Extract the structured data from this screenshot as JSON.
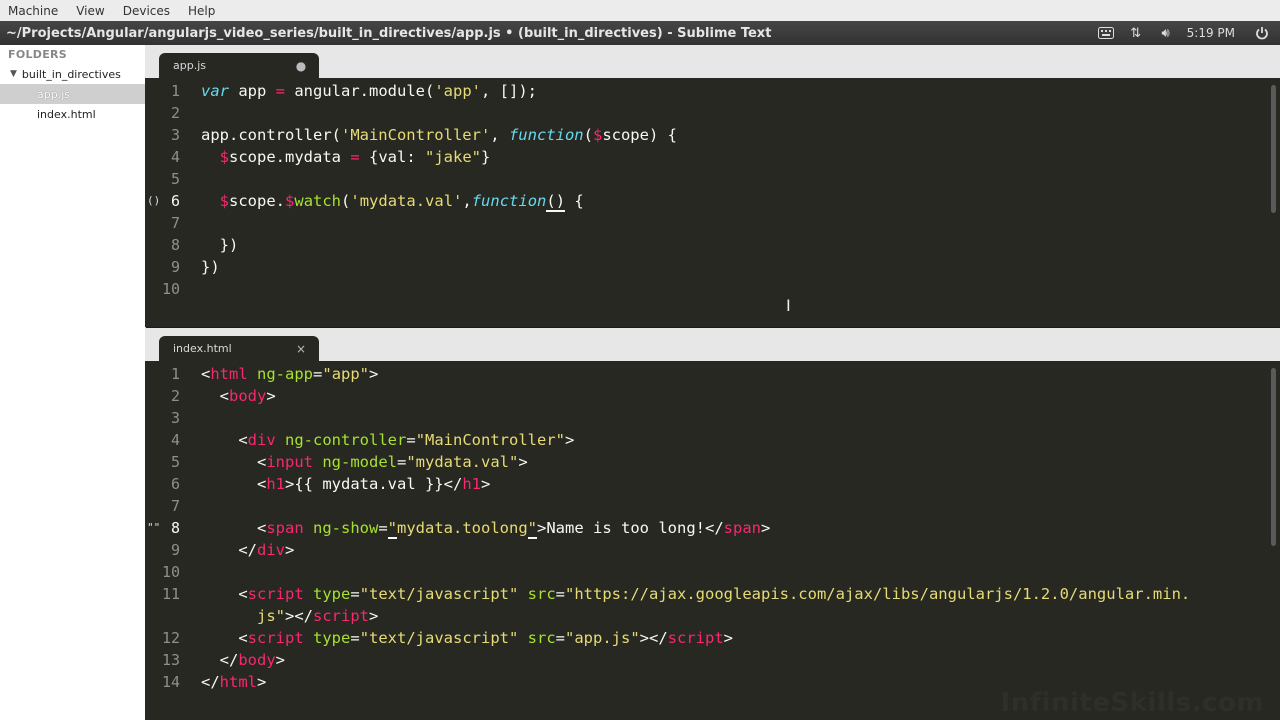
{
  "vm_menu": [
    "Machine",
    "View",
    "Devices",
    "Help"
  ],
  "window_title": "~/Projects/Angular/angularjs_video_series/built_in_directives/app.js • (built_in_directives) - Sublime Text",
  "tray": {
    "clock": "5:19 PM"
  },
  "sidebar": {
    "header": "FOLDERS",
    "folder": "built_in_directives",
    "files": [
      {
        "name": "app.js",
        "selected": true
      },
      {
        "name": "index.html",
        "selected": false
      }
    ]
  },
  "top_pane": {
    "tab": {
      "name": "app.js",
      "state": "●"
    },
    "line_numbers": [
      "1",
      "2",
      "3",
      "4",
      "5",
      "6",
      "7",
      "8",
      "9",
      "10"
    ]
  },
  "bottom_pane": {
    "tab": {
      "name": "index.html",
      "state": "×"
    },
    "line_numbers": [
      "1",
      "2",
      "3",
      "4",
      "5",
      "6",
      "7",
      "8",
      "9",
      "10",
      "11",
      "",
      "12",
      "13",
      "14"
    ]
  },
  "watermark": "InfiniteSkills.com",
  "colors": {
    "editor_bg": "#272822",
    "keyword": "#66d9ef",
    "string": "#e6db74",
    "tag": "#f92672",
    "attribute": "#a6e22e"
  }
}
